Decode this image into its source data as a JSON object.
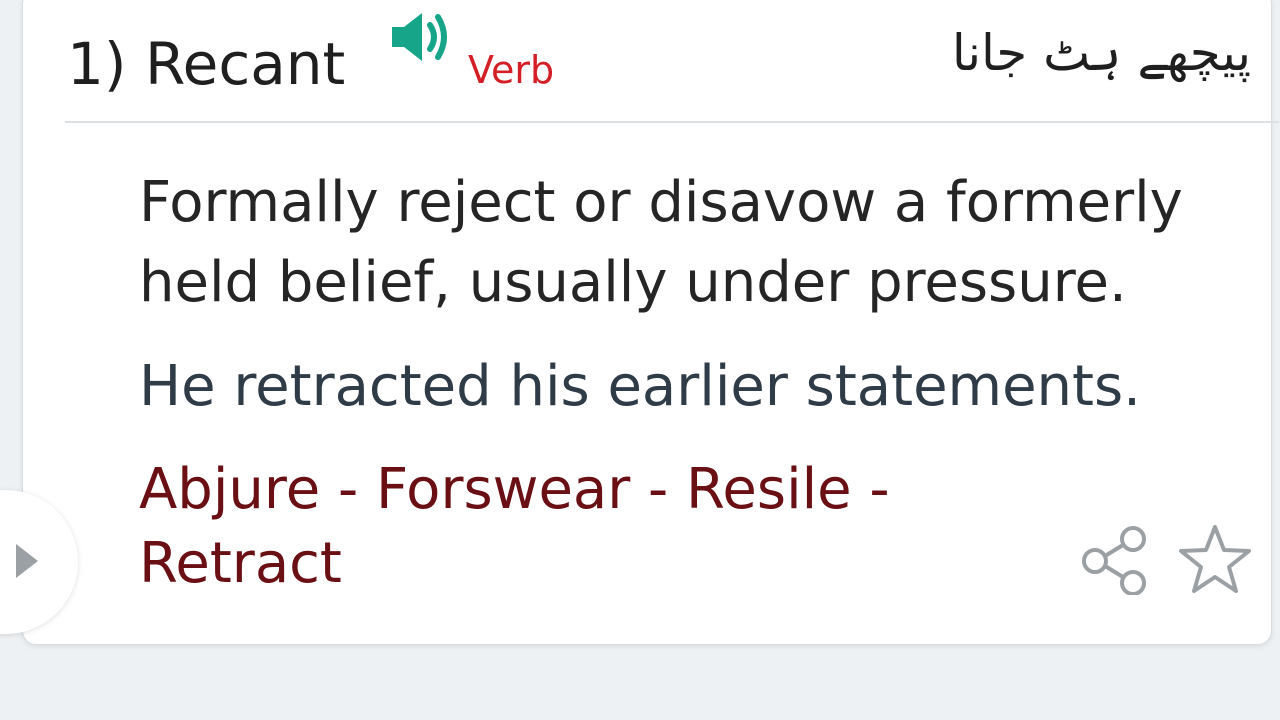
{
  "entry": {
    "number_word": "1) Recant",
    "part_of_speech": "Verb",
    "urdu_meaning": "پیچھے ہٹ جانا",
    "definition": "Formally reject or disavow a formerly held belief, usually under pressure.",
    "example": "He retracted his earlier statements.",
    "synonyms_line1": "Abjure - Forswear - Resile -",
    "synonyms_line2": "Retract"
  },
  "icons": {
    "speaker": "speaker-icon",
    "share": "share-icon",
    "star": "star-icon",
    "side_arrow": "chevron-right-icon"
  },
  "colors": {
    "speaker": "#17a589",
    "part_of_speech": "#d41f26",
    "synonyms": "#6a0f14",
    "icon_gray": "#9aa0a4"
  }
}
